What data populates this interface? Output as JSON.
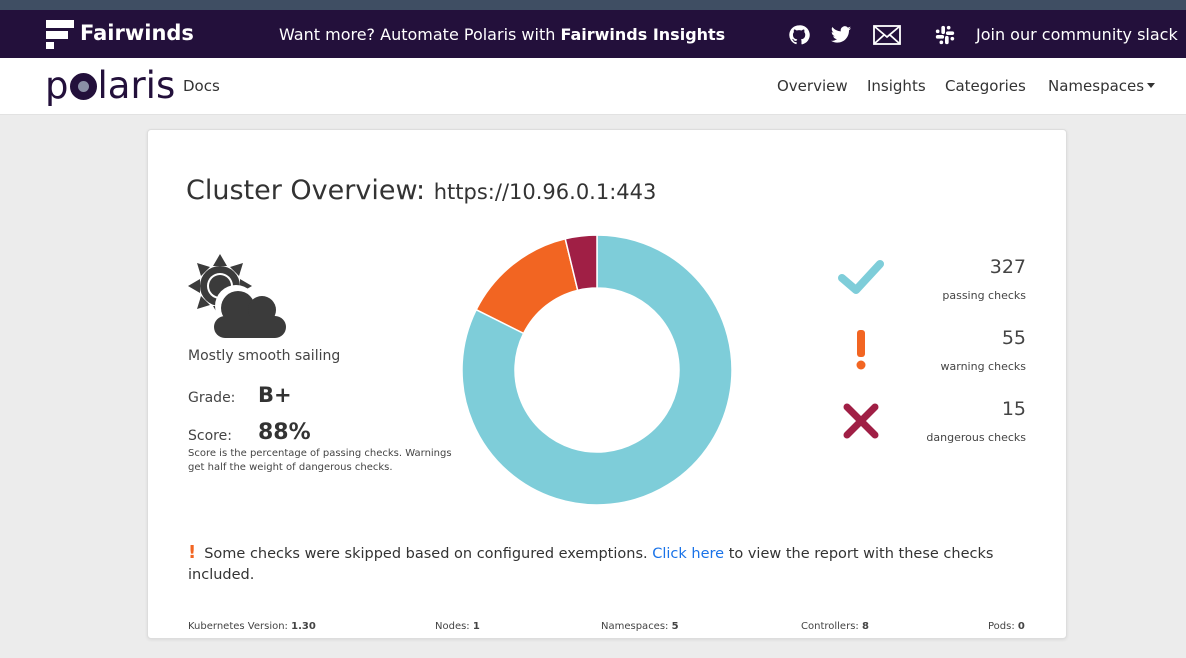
{
  "banner": {
    "brand": "Fairwinds",
    "promo_prefix": "Want more? Automate Polaris with ",
    "promo_bold": "Fairwinds Insights",
    "slack_label": "Join our community slack",
    "icons": [
      "github-icon",
      "twitter-icon",
      "mail-icon",
      "slack-icon"
    ]
  },
  "nav": {
    "logo_left": "p",
    "logo_right": "laris",
    "docs": "Docs",
    "items": [
      "Overview",
      "Insights",
      "Categories",
      "Namespaces"
    ]
  },
  "overview": {
    "title": "Cluster Overview:",
    "url": "https://10.96.0.1:443",
    "weather_text": "Mostly smooth sailing",
    "grade_label": "Grade:",
    "grade": "B+",
    "score_label": "Score:",
    "score": "88%",
    "score_note": "Score is the percentage of passing checks. Warnings get half the weight of dangerous checks."
  },
  "chart_data": {
    "type": "pie",
    "categories": [
      "passing checks",
      "warning checks",
      "dangerous checks"
    ],
    "values": [
      327,
      55,
      15
    ],
    "colors": [
      "#7ecdd9",
      "#f26522",
      "#a01f45"
    ]
  },
  "stats": [
    {
      "value": "327",
      "label": "passing checks",
      "icon": "checkmark-icon",
      "color": "#7ecdd9"
    },
    {
      "value": "55",
      "label": "warning checks",
      "icon": "exclamation-icon",
      "color": "#f26522"
    },
    {
      "value": "15",
      "label": "dangerous checks",
      "icon": "x-icon",
      "color": "#a01f45"
    }
  ],
  "notice": {
    "text_before": "Some checks were skipped based on configured exemptions.",
    "link": "Click here",
    "text_after": "to view the report with these checks included."
  },
  "footer": [
    {
      "label": "Kubernetes Version:",
      "value": "1.30"
    },
    {
      "label": "Nodes:",
      "value": "1"
    },
    {
      "label": "Namespaces:",
      "value": "5"
    },
    {
      "label": "Controllers:",
      "value": "8"
    },
    {
      "label": "Pods:",
      "value": "0"
    }
  ]
}
